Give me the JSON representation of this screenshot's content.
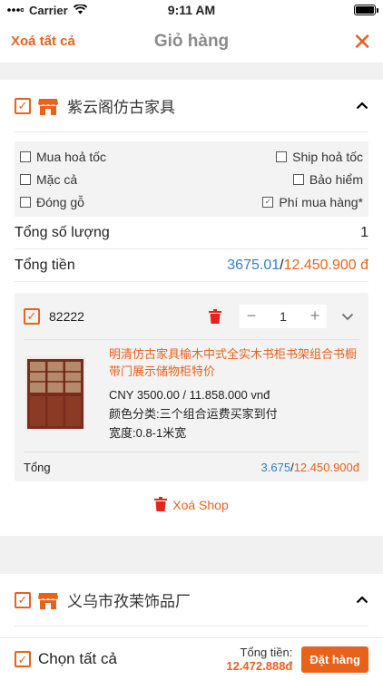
{
  "status": {
    "carrier": "Carrier",
    "time": "9:11 AM"
  },
  "nav": {
    "left": "Xoá tất cả",
    "title": "Giỏ hàng",
    "close": "✕"
  },
  "shop1": {
    "name": "紫云阁仿古家具",
    "options": {
      "express_buy": "Mua hoả tốc",
      "express_ship": "Ship hoả tốc",
      "bargain": "Mặc cả",
      "insurance": "Bảo hiểm",
      "wood_pack": "Đóng gỗ",
      "purchase_fee": "Phí mua hàng*"
    },
    "qty_label": "Tổng số lượng",
    "qty_value": "1",
    "money_label": "Tổng tiền",
    "money_cny": "3675.01",
    "sep": "/",
    "money_vnd": "12.450.900 đ",
    "item": {
      "code": "82222",
      "quantity": "1",
      "minus": "−",
      "plus": "+",
      "title": "明清仿古家具榆木中式全实木书柜书架组合书橱带门展示储物柜特价",
      "price": "CNY 3500.00 / 11.858.000 vnđ",
      "attr1": "颜色分类:三个组合运费买家到付",
      "attr2": "宽度:0.8-1米宽",
      "total_label": "Tổng",
      "total_cny": "3.675",
      "total_sep": "/",
      "total_vnd": "12.450.900đ"
    },
    "delete_shop": "Xoá Shop"
  },
  "shop2": {
    "name": "义乌市孜茉饰品厂"
  },
  "footer": {
    "select_all": "Chọn tất cả",
    "total_label": "Tổng tiền:",
    "total_value": "12.472.888đ",
    "order_button": "Đặt hàng"
  },
  "colors": {
    "accent": "#e8621c",
    "link": "#2f7fd1"
  }
}
